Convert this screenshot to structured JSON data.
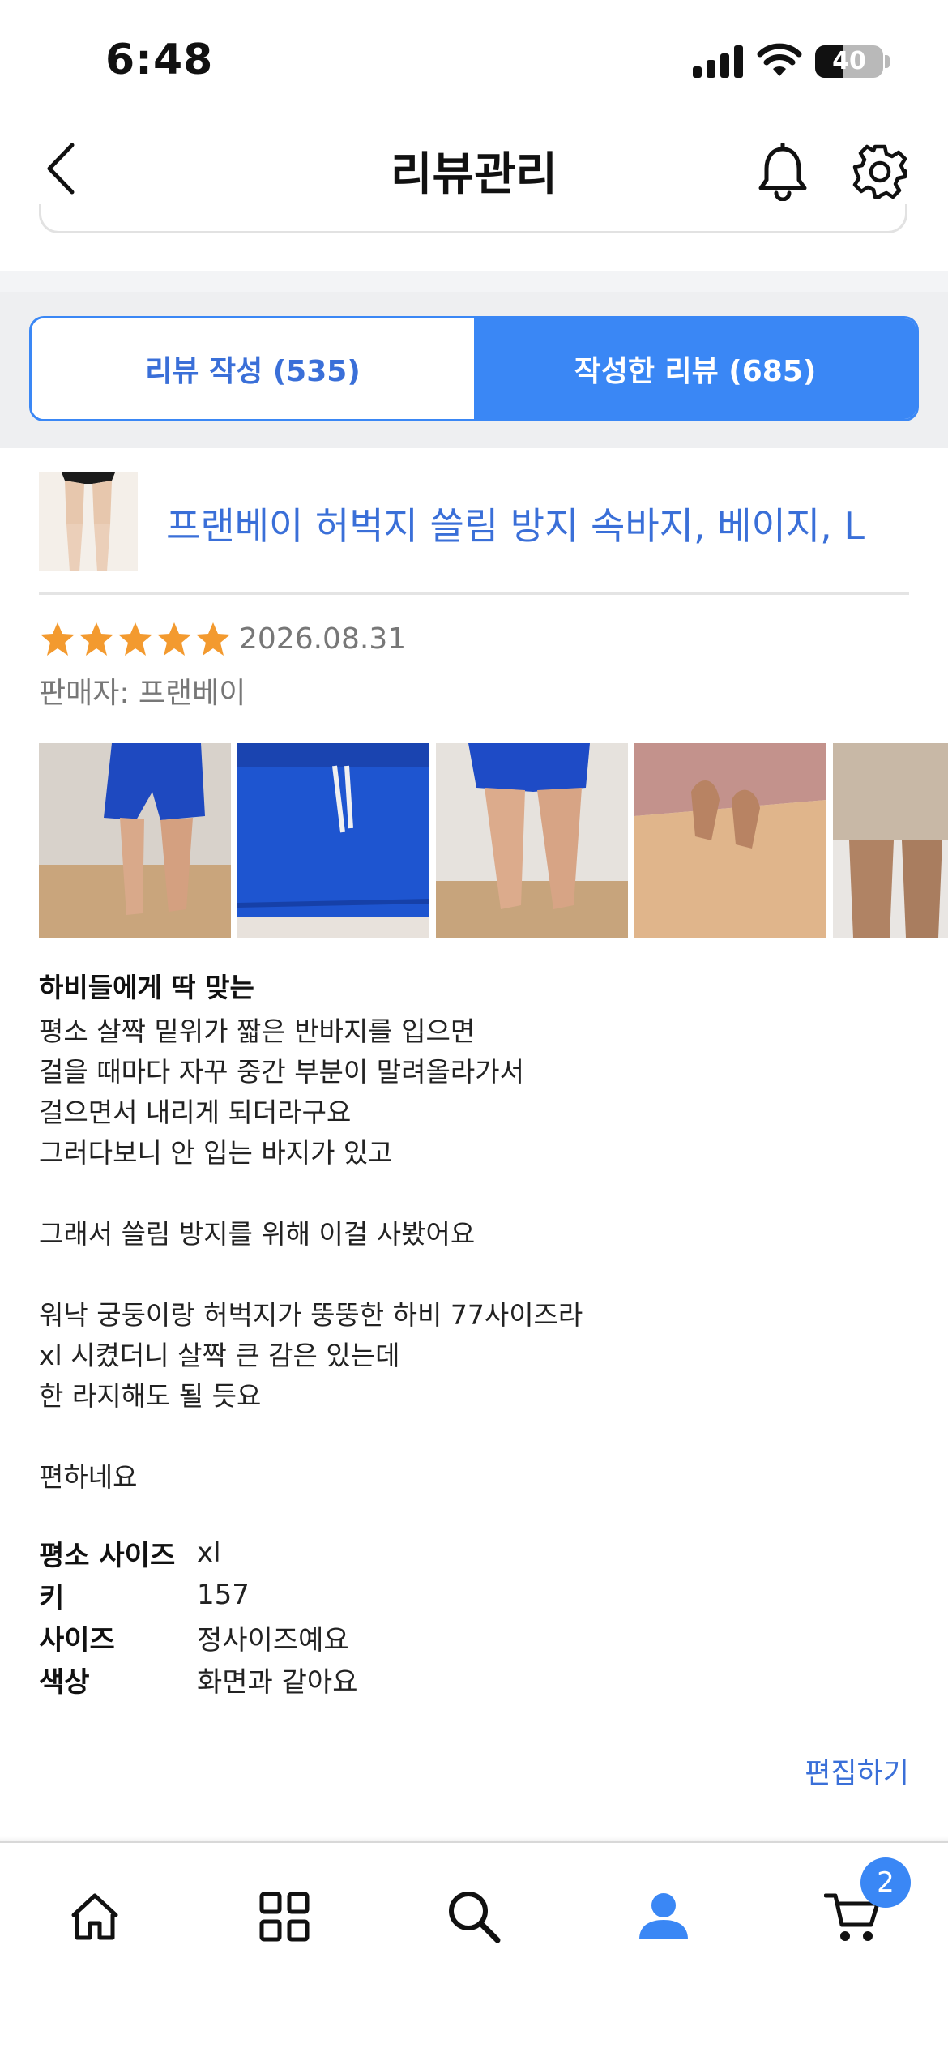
{
  "status_bar": {
    "time": "6:48",
    "battery": "40"
  },
  "header": {
    "title": "리뷰관리",
    "icons": {
      "back": "chevron-left-icon",
      "bell": "bell-icon",
      "settings": "gear-icon"
    }
  },
  "tabs": [
    {
      "label": "리뷰 작성 (535)",
      "active": false
    },
    {
      "label": "작성한 리뷰 (685)",
      "active": true
    }
  ],
  "review": {
    "product_name": "프랜베이 허벅지 쓸림 방지 속바지, 베이지, L",
    "rating": 5,
    "date": "2026.08.31",
    "seller": "판매자: 프랜베이",
    "photo_count": 5,
    "title": "하비들에게 딱 맞는",
    "body": "평소 살짝 밑위가 짧은 반바지를 입으면\n걸을 때마다 자꾸 중간 부분이 말려올라가서\n걸으면서 내리게 되더라구요\n그러다보니 안 입는 바지가 있고\n\n그래서 쓸림 방지를 위해 이걸 사봤어요\n\n워낙 궁둥이랑 허벅지가 뚱뚱한 하비 77사이즈라\nxl 시켰더니 살짝 큰 감은 있는데\n한 라지해도 될 듯요\n\n편하네요",
    "details": [
      {
        "label": "평소 사이즈",
        "value": "xl"
      },
      {
        "label": "키",
        "value": "157"
      },
      {
        "label": "사이즈",
        "value": "정사이즈예요"
      },
      {
        "label": "색상",
        "value": "화면과 같아요"
      }
    ],
    "edit_label": "편집하기"
  },
  "bottom_nav": {
    "items": [
      "home-icon",
      "categories-icon",
      "search-icon",
      "profile-icon",
      "cart-icon"
    ],
    "active": "profile-icon",
    "cart_badge": "2"
  },
  "colors": {
    "accent": "#3a87f5",
    "link": "#3a6fd8",
    "star": "#f39a2f"
  }
}
